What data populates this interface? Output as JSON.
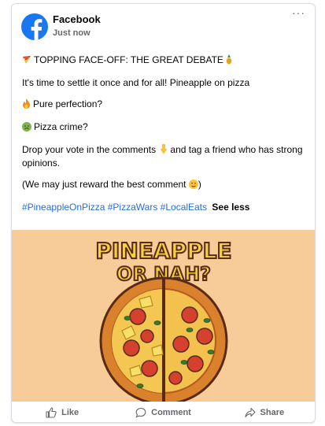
{
  "post": {
    "page_name": "Facebook",
    "timestamp": "Just now",
    "headline": "TOPPING FACE-OFF: THE GREAT DEBATE",
    "intro": "It's time to settle it once and for all! Pineapple on pizza",
    "option1": "Pure perfection?",
    "option2": "Pizza crime?",
    "cta_part1": "Drop your vote in the comments",
    "cta_part2": "and tag a friend who has strong opinions.",
    "reward": "(We may just reward the best comment",
    "reward_end": ")",
    "hashtags": [
      "#PineappleOnPizza",
      "#PizzaWars",
      "#LocalEats"
    ],
    "see_less": "See less",
    "more_label": "···"
  },
  "image": {
    "line1": "PINEAPPLE",
    "line2": "OR NAH?"
  },
  "actions": {
    "like": "Like",
    "comment": "Comment",
    "share": "Share"
  },
  "icons": {
    "headline_start": "pizza-icon",
    "headline_end": "pineapple-icon",
    "option1": "fire-icon",
    "option2": "nauseated-face-icon",
    "cta": "pointing-down-icon",
    "reward": "winking-face-icon"
  },
  "colors": {
    "brand": "#1877f2",
    "link": "#216fdb",
    "image_background": "#f8cc98"
  }
}
